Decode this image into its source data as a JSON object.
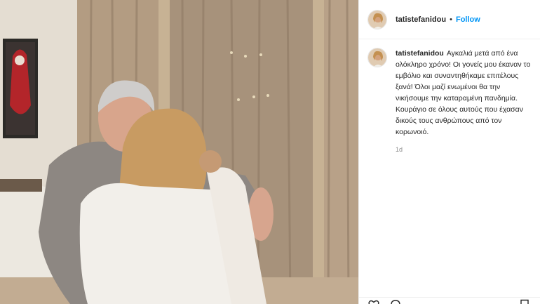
{
  "header": {
    "username": "tatistefanidou",
    "separator": "•",
    "follow_label": "Follow",
    "avatar_icon": "profile-avatar"
  },
  "caption": {
    "username": "tatistefanidou",
    "text": "Αγκαλιά μετά από ένα ολόκληρο χρόνο! Οι γονείς μου έκαναν το εμβόλιο και συναντηθήκαμε επιτέλους ξανά! Όλοι μαζί ενωμένοι θα την νικήσουμε την καταραμένη πανδημία. Κουράγιο σε όλους αυτούς που έχασαν δικούς τους ανθρώπους από τον κορωνοιό.",
    "time": "1d"
  },
  "actions": {
    "icons": [
      "heart-icon",
      "comment-icon",
      "share-icon",
      "bookmark-icon"
    ]
  },
  "colors": {
    "link": "#0095f6",
    "text": "#262626",
    "muted": "#8e8e8e",
    "divider": "#efefef"
  }
}
